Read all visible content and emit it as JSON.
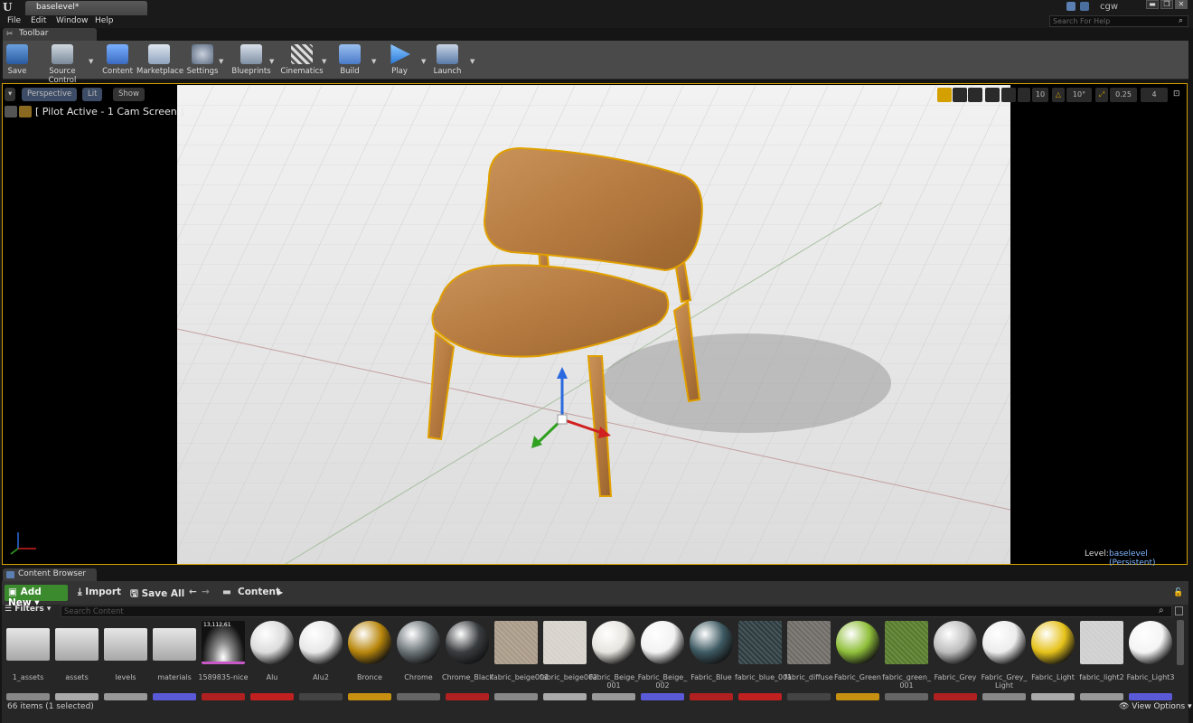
{
  "window": {
    "tab_title": "baselevel*",
    "user": "cgw",
    "minimize": "▬",
    "restore": "❐",
    "close": "✕"
  },
  "menu": {
    "items": [
      "File",
      "Edit",
      "Window",
      "Help"
    ],
    "help_search_placeholder": "Search For Help"
  },
  "toolbar": {
    "tab_label": "Toolbar",
    "buttons": [
      "Save",
      "Source Control",
      "Content",
      "Marketplace",
      "Settings",
      "Blueprints",
      "Cinematics",
      "Build",
      "Play",
      "Launch"
    ]
  },
  "viewport": {
    "perspective": "Perspective",
    "lit": "Lit",
    "show": "Show",
    "pilot_label": "[ Pilot Active - 1 Cam Screen ]",
    "grid_snap": "10",
    "rotation_snap": "10°",
    "scale_snap": "0.25",
    "camera_speed": "4",
    "level_label": "Level:",
    "level_value": "baselevel (Persistent)"
  },
  "content_browser": {
    "tab_label": "Content Browser",
    "add_new": "Add New",
    "import": "Import",
    "save_all": "Save All",
    "path": "Content",
    "filters": "Filters",
    "search_placeholder": "Search Content",
    "assets": [
      {
        "label": "1_assets",
        "kind": "folder"
      },
      {
        "label": "assets",
        "kind": "folder"
      },
      {
        "label": "levels",
        "kind": "folder"
      },
      {
        "label": "materials",
        "kind": "folder"
      },
      {
        "label": "1589835-nice",
        "kind": "texture",
        "badge": "13,112,61"
      },
      {
        "label": "Alu",
        "kind": "sphere",
        "color": "#dcdcdc"
      },
      {
        "label": "Alu2",
        "kind": "sphere",
        "color": "#e8e8e8"
      },
      {
        "label": "Bronce",
        "kind": "sphere",
        "color": "#b8860b"
      },
      {
        "label": "Chrome",
        "kind": "sphere",
        "color": "#6c7478"
      },
      {
        "label": "Chrome_Black",
        "kind": "sphere",
        "color": "#3a3d40"
      },
      {
        "label": "fabric_beige001",
        "kind": "flat",
        "color": "#a89a86"
      },
      {
        "label": "fabric_beige002",
        "kind": "flat",
        "color": "#d6d2cb"
      },
      {
        "label": "Fabric_Beige_\n001",
        "kind": "sphere",
        "color": "#e6e4de"
      },
      {
        "label": "Fabric_Beige_\n002",
        "kind": "sphere",
        "color": "#f2f2f2"
      },
      {
        "label": "Fabric_Blue",
        "kind": "sphere",
        "color": "#3e5a63"
      },
      {
        "label": "fabric_blue_001",
        "kind": "flat",
        "color": "#2c3b40"
      },
      {
        "label": "fabric_diffuse",
        "kind": "flat",
        "color": "#6e6a66"
      },
      {
        "label": "Fabric_Green",
        "kind": "sphere",
        "color": "#8fbf3a"
      },
      {
        "label": "fabric_green_\n001",
        "kind": "flat",
        "color": "#557a2a"
      },
      {
        "label": "Fabric_Grey",
        "kind": "sphere",
        "color": "#bdbdbd"
      },
      {
        "label": "Fabric_Grey_\nLight",
        "kind": "sphere",
        "color": "#ececec"
      },
      {
        "label": "Fabric_Light",
        "kind": "sphere",
        "color": "#e6c21a"
      },
      {
        "label": "fabric_light2",
        "kind": "flat",
        "color": "#cfcfcf"
      },
      {
        "label": "Fabric_Light3",
        "kind": "sphere",
        "color": "#f4f4f4"
      }
    ],
    "items_count": "66 items (1 selected)",
    "view_options": "View Options"
  },
  "colors": {
    "accent": "#d4a000",
    "add_new": "#3b8a2d",
    "pilot_bg": "#3d4c66"
  }
}
